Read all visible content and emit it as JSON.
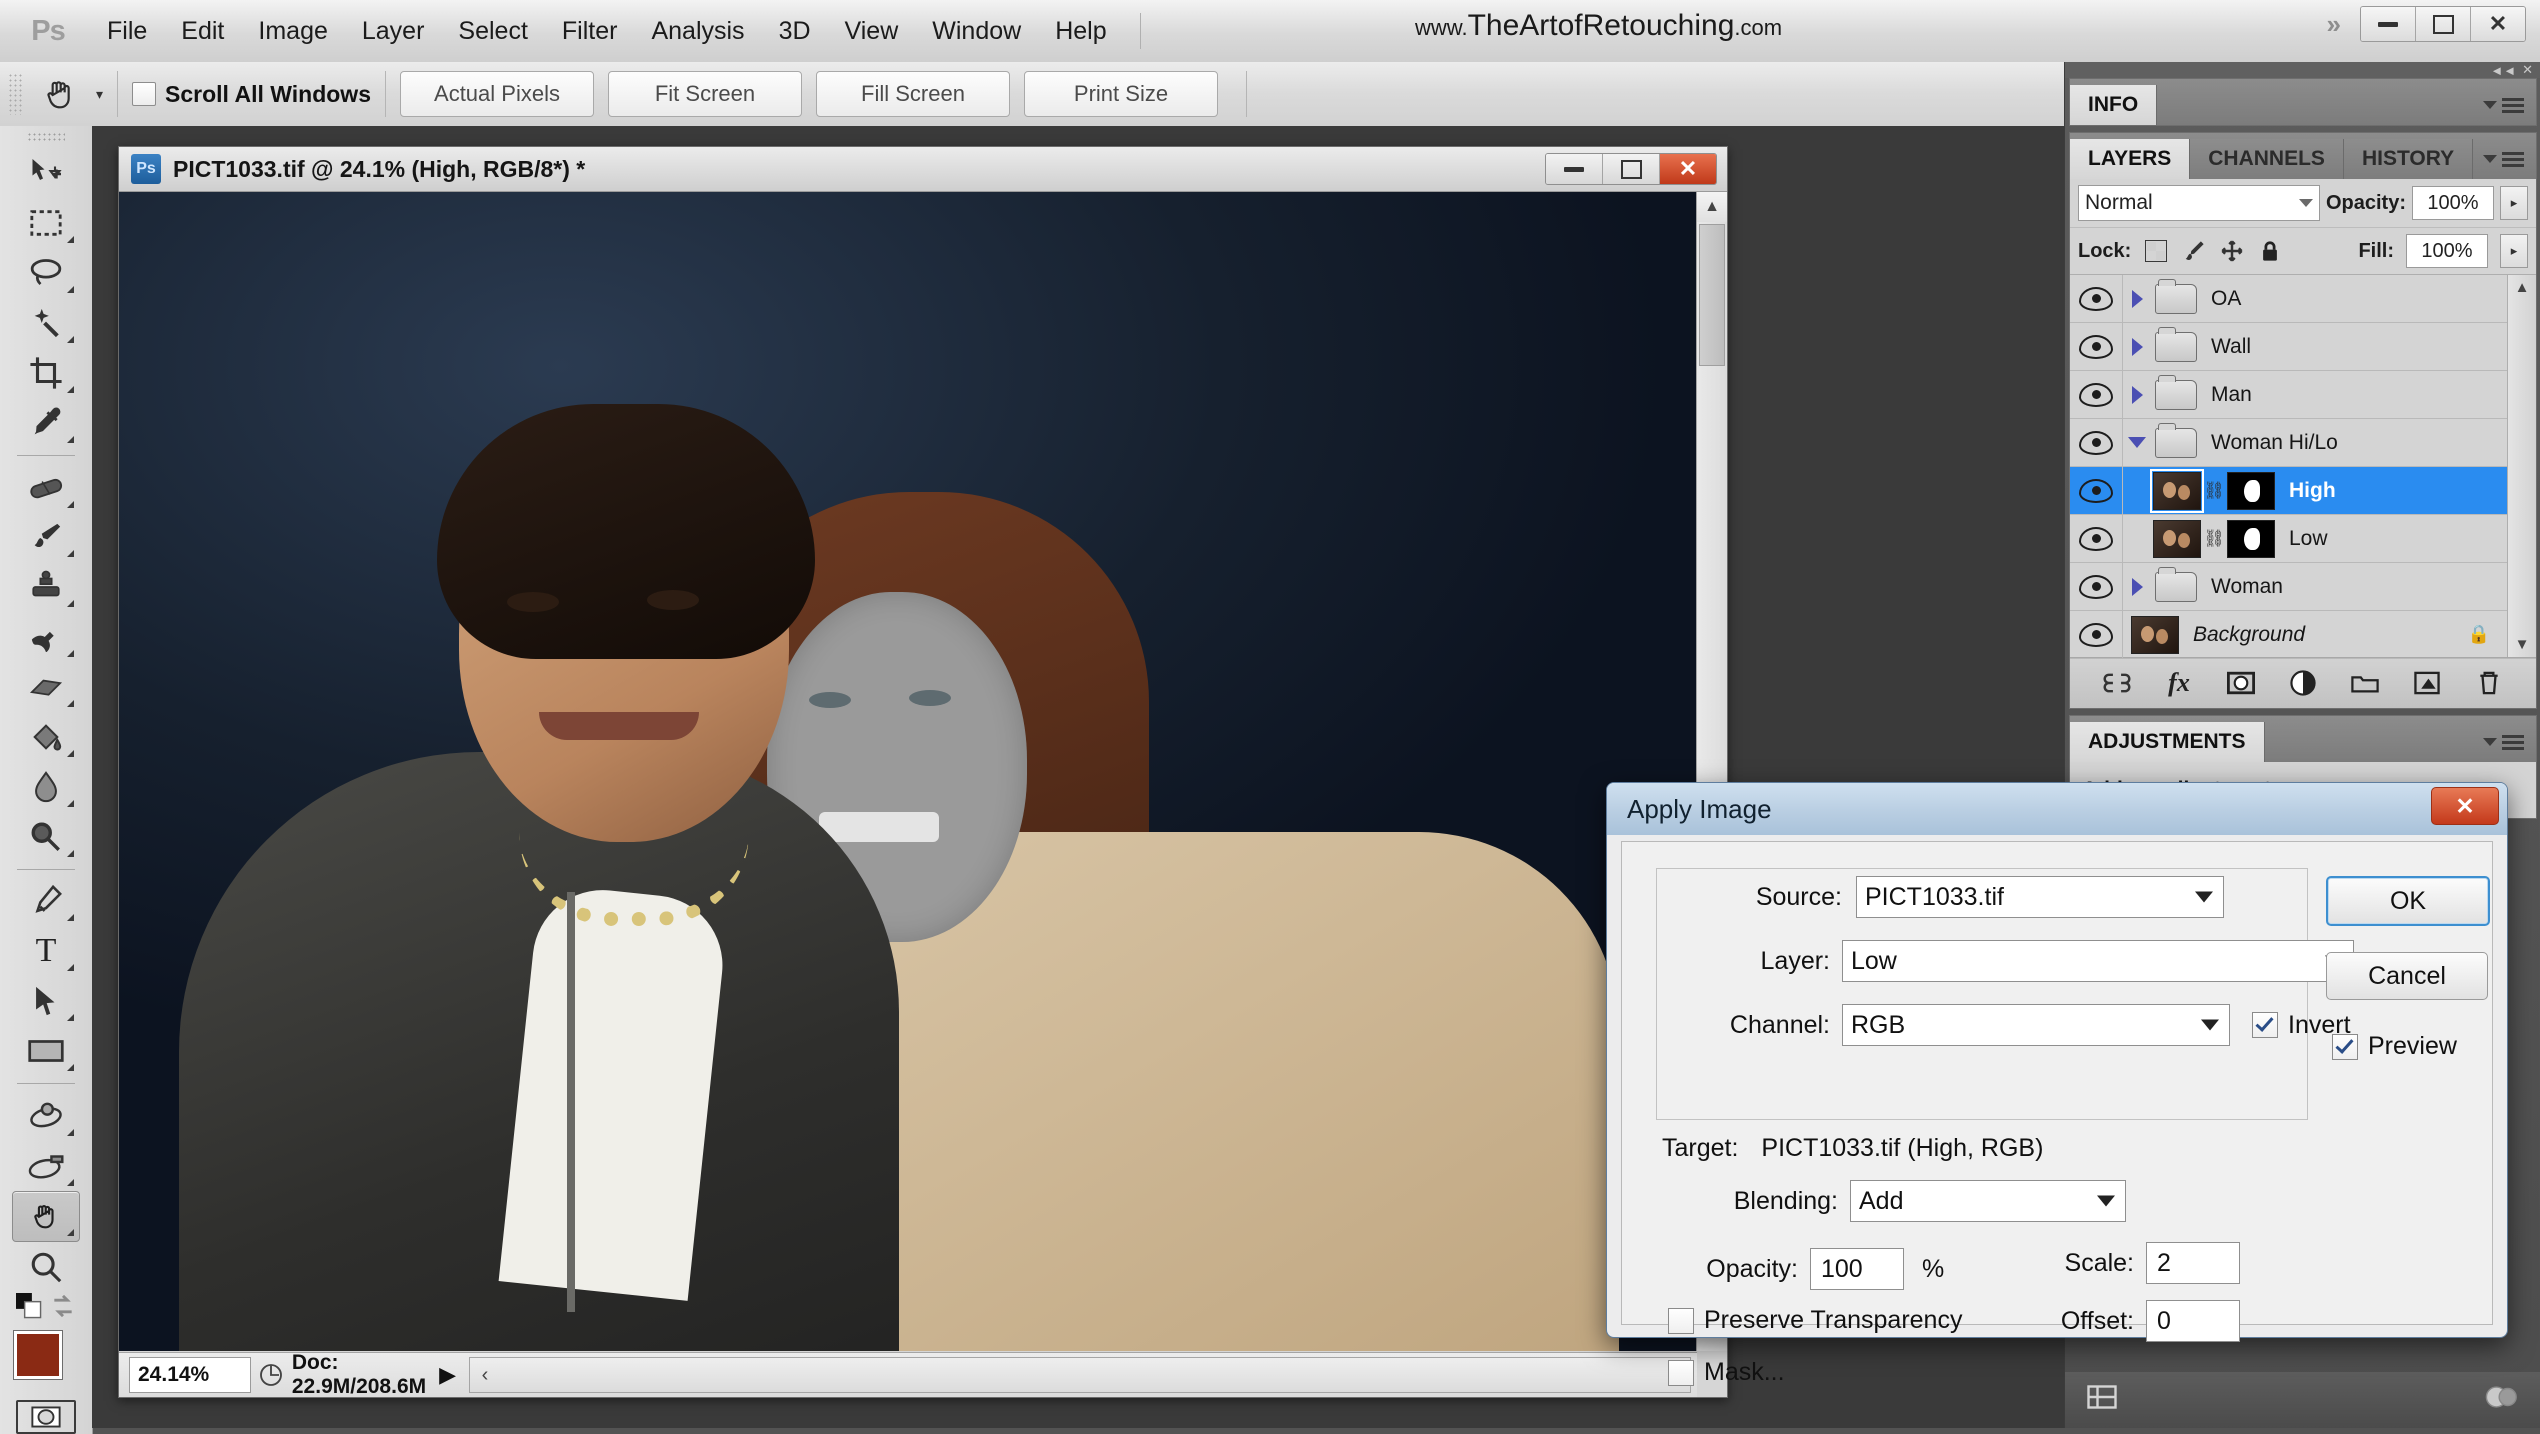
{
  "app": {
    "logo": "Ps",
    "brand_www": "www.",
    "brand_name": "TheArtofRetouching",
    "brand_tld": ".com",
    "menu": [
      "File",
      "Edit",
      "Image",
      "Layer",
      "Select",
      "Filter",
      "Analysis",
      "3D",
      "View",
      "Window",
      "Help"
    ],
    "expand_icon": "»",
    "window_buttons": [
      "minimize",
      "maximize",
      "close"
    ]
  },
  "options_bar": {
    "tool_icon": "hand-tool-icon",
    "preset_caret": "▾",
    "scroll_all_windows": {
      "label": "Scroll All Windows",
      "checked": false
    },
    "buttons": [
      "Actual Pixels",
      "Fit Screen",
      "Fill Screen",
      "Print Size"
    ]
  },
  "toolbar": {
    "tools": [
      "move-tool",
      "rectangular-marquee-tool",
      "lasso-tool",
      "magic-wand-tool",
      "crop-tool",
      "eyedropper-tool",
      "healing-brush-tool",
      "brush-tool",
      "clone-stamp-tool",
      "history-brush-tool",
      "eraser-tool",
      "paint-bucket-tool",
      "blur-tool",
      "dodge-tool",
      "pen-tool",
      "type-tool",
      "path-selection-tool",
      "rectangle-shape-tool",
      "3d-rotate-tool",
      "3d-camera-tool",
      "hand-tool",
      "zoom-tool"
    ],
    "selected_tool": "hand-tool",
    "foreground_color": "#8a2a14",
    "background_color": "#ffffff",
    "quick_mask": "quick-mask-icon"
  },
  "document": {
    "icon": "Ps",
    "title": "PICT1033.tif @ 24.1% (High, RGB/8*) *",
    "window_buttons": [
      "minimize",
      "maximize",
      "close"
    ],
    "status": {
      "zoom": "24.14%",
      "doc_icon": "doc-size-icon",
      "doc_info": "Doc: 22.9M/208.6M",
      "menu_arrow": "▶",
      "scroll_left_arrow": "‹",
      "scroll_right_arrow": "›"
    }
  },
  "panels": {
    "info": {
      "tab": "INFO"
    },
    "layers": {
      "tabs": [
        "LAYERS",
        "CHANNELS",
        "HISTORY"
      ],
      "active_tab": "LAYERS",
      "blend_mode": "Normal",
      "opacity_label": "Opacity:",
      "opacity_value": "100%",
      "lock_label": "Lock:",
      "lock_icons": [
        "lock-transparency-icon",
        "lock-image-icon",
        "lock-position-icon",
        "lock-all-icon"
      ],
      "fill_label": "Fill:",
      "fill_value": "100%",
      "rows": [
        {
          "name": "OA",
          "type": "group",
          "visible": true,
          "expanded": false,
          "selected": false
        },
        {
          "name": "Wall",
          "type": "group",
          "visible": true,
          "expanded": false,
          "selected": false
        },
        {
          "name": "Man",
          "type": "group",
          "visible": true,
          "expanded": false,
          "selected": false
        },
        {
          "name": "Woman Hi/Lo",
          "type": "group",
          "visible": true,
          "expanded": true,
          "selected": false
        },
        {
          "name": "High",
          "type": "layer",
          "visible": true,
          "selected": true,
          "masked": true,
          "linked": true
        },
        {
          "name": "Low",
          "type": "layer",
          "visible": true,
          "selected": false,
          "masked": true,
          "linked": true
        },
        {
          "name": "Woman",
          "type": "group",
          "visible": true,
          "expanded": false,
          "selected": false
        },
        {
          "name": "Background",
          "type": "layer",
          "visible": true,
          "selected": false,
          "locked": true
        }
      ],
      "footer_icons": [
        "link-layers-icon",
        "layer-style-fx-icon",
        "add-layer-mask-icon",
        "new-adjustment-layer-icon",
        "new-group-icon",
        "new-layer-icon",
        "delete-layer-icon"
      ]
    },
    "adjustments": {
      "tab": "ADJUSTMENTS",
      "text": "Add an adjustment"
    },
    "dock_bottom_icons": [
      "screen-mode-icon",
      "color-wheel-icon"
    ]
  },
  "dialog": {
    "title": "Apply Image",
    "close_glyph": "✕",
    "source_label": "Source:",
    "source_value": "PICT1033.tif",
    "layer_label": "Layer:",
    "layer_value": "Low",
    "channel_label": "Channel:",
    "channel_value": "RGB",
    "invert_label": "Invert",
    "invert_checked": true,
    "target_label": "Target:",
    "target_value": "PICT1033.tif (High, RGB)",
    "blending_label": "Blending:",
    "blending_value": "Add",
    "opacity_label": "Opacity:",
    "opacity_value": "100",
    "percent_sign": "%",
    "scale_label": "Scale:",
    "scale_value": "2",
    "offset_label": "Offset:",
    "offset_value": "0",
    "preserve_transparency_label": "Preserve Transparency",
    "preserve_transparency_checked": false,
    "mask_label": "Mask...",
    "mask_checked": false,
    "ok_label": "OK",
    "cancel_label": "Cancel",
    "preview_label": "Preview",
    "preview_checked": true
  }
}
